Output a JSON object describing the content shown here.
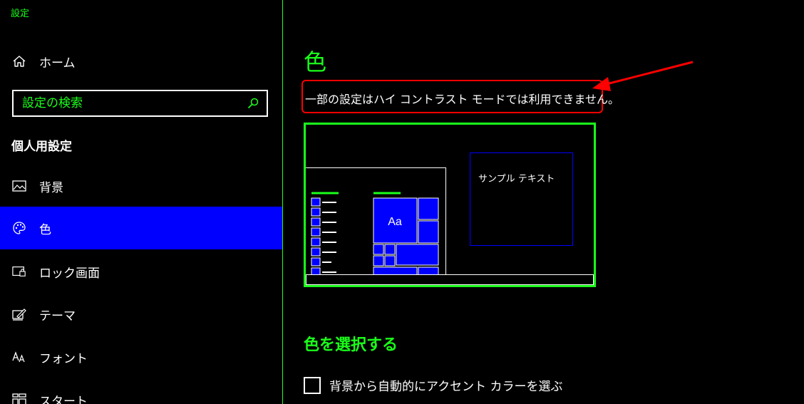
{
  "window": {
    "title": "設定"
  },
  "sidebar": {
    "home_label": "ホーム",
    "search": {
      "placeholder": "設定の検索",
      "value": ""
    },
    "section_heading": "個人用設定",
    "items": [
      {
        "label": "背景",
        "icon": "picture-icon",
        "active": false
      },
      {
        "label": "色",
        "icon": "palette-icon",
        "active": true
      },
      {
        "label": "ロック画面",
        "icon": "lock-screen-icon",
        "active": false
      },
      {
        "label": "テーマ",
        "icon": "theme-brush-icon",
        "active": false
      },
      {
        "label": "フォント",
        "icon": "font-icon",
        "active": false
      },
      {
        "label": "スタート",
        "icon": "start-grid-icon",
        "active": false
      }
    ]
  },
  "main": {
    "title": "色",
    "notice": "一部の設定はハイ コントラスト モードでは利用できません。",
    "preview": {
      "sample_text": "サンプル テキスト",
      "tile_label": "Aa"
    },
    "choose_color_heading": "色を選択する",
    "auto_accent_checkbox": {
      "label": "背景から自動的にアクセント カラーを選ぶ",
      "checked": false
    }
  },
  "colors": {
    "accent_green": "#1aff1a",
    "selection_blue": "#0000ff",
    "notice_border_red": "#ff0000",
    "background": "#000000",
    "text": "#ffffff"
  }
}
